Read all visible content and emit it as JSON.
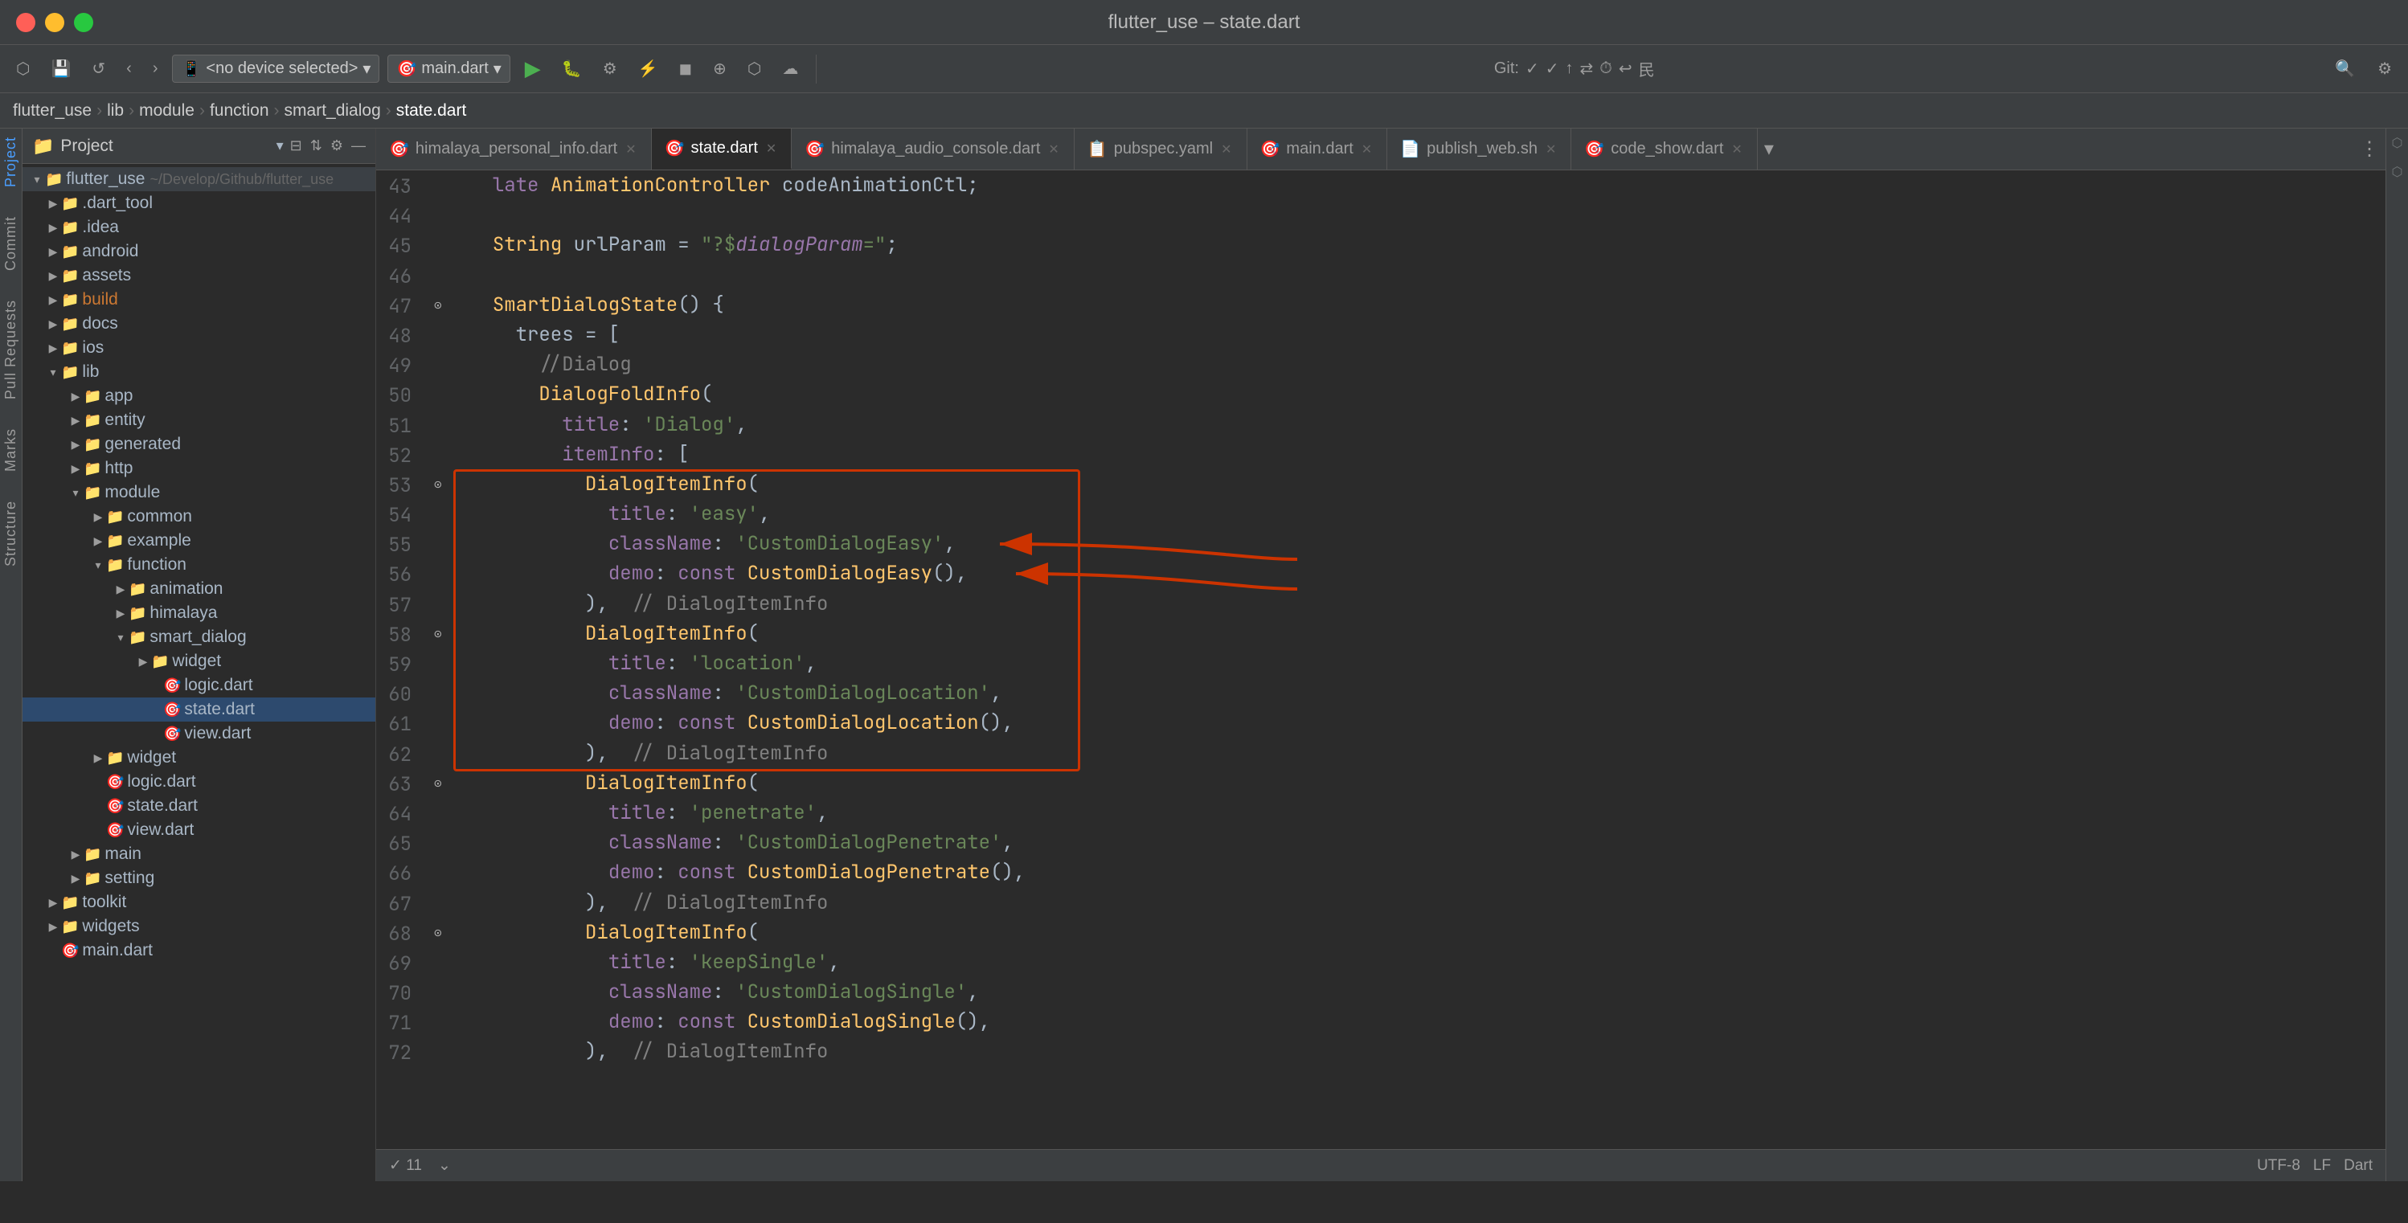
{
  "window": {
    "title": "flutter_use – state.dart"
  },
  "traffic_lights": {
    "close": "close",
    "minimize": "minimize",
    "maximize": "maximize"
  },
  "toolbar": {
    "back_label": "‹",
    "forward_label": "›",
    "device_selector": "<no device selected>",
    "file_selector": "main.dart",
    "run_label": "▶",
    "git_label": "Git:",
    "search_label": "🔍",
    "settings_label": "⚙"
  },
  "breadcrumb": {
    "items": [
      "flutter_use",
      "lib",
      "module",
      "function",
      "smart_dialog",
      "state.dart"
    ]
  },
  "sidebar": {
    "project_label": "Project",
    "labels": [
      "Project",
      "Commit",
      "Pull Requests",
      "Marks",
      "Structure"
    ]
  },
  "file_tree": {
    "root": "flutter_use",
    "root_path": "~/Develop/Github/flutter_use",
    "items": [
      {
        "type": "folder",
        "name": ".dart_tool",
        "level": 1,
        "collapsed": true,
        "color": "orange"
      },
      {
        "type": "folder",
        "name": ".idea",
        "level": 1,
        "collapsed": true
      },
      {
        "type": "folder",
        "name": "android",
        "level": 1,
        "collapsed": true
      },
      {
        "type": "folder",
        "name": "assets",
        "level": 1,
        "collapsed": true
      },
      {
        "type": "folder",
        "name": "build",
        "level": 1,
        "collapsed": true,
        "color": "orange"
      },
      {
        "type": "folder",
        "name": "docs",
        "level": 1,
        "collapsed": true
      },
      {
        "type": "folder",
        "name": "ios",
        "level": 1,
        "collapsed": true
      },
      {
        "type": "folder",
        "name": "lib",
        "level": 1,
        "collapsed": false
      },
      {
        "type": "folder",
        "name": "app",
        "level": 2,
        "collapsed": true
      },
      {
        "type": "folder",
        "name": "entity",
        "level": 2,
        "collapsed": true
      },
      {
        "type": "folder",
        "name": "generated",
        "level": 2,
        "collapsed": true
      },
      {
        "type": "folder",
        "name": "http",
        "level": 2,
        "collapsed": true
      },
      {
        "type": "folder",
        "name": "module",
        "level": 2,
        "collapsed": false
      },
      {
        "type": "folder",
        "name": "common",
        "level": 3,
        "collapsed": true
      },
      {
        "type": "folder",
        "name": "example",
        "level": 3,
        "collapsed": true
      },
      {
        "type": "folder",
        "name": "function",
        "level": 3,
        "collapsed": false
      },
      {
        "type": "folder",
        "name": "animation",
        "level": 4,
        "collapsed": true
      },
      {
        "type": "folder",
        "name": "himalaya",
        "level": 4,
        "collapsed": true
      },
      {
        "type": "folder",
        "name": "smart_dialog",
        "level": 4,
        "collapsed": false
      },
      {
        "type": "folder",
        "name": "widget",
        "level": 5,
        "collapsed": true
      },
      {
        "type": "file",
        "name": "logic.dart",
        "level": 5,
        "ext": "dart"
      },
      {
        "type": "file",
        "name": "state.dart",
        "level": 5,
        "ext": "dart",
        "selected": true
      },
      {
        "type": "file",
        "name": "view.dart",
        "level": 5,
        "ext": "dart"
      },
      {
        "type": "folder",
        "name": "widget",
        "level": 3,
        "collapsed": true
      },
      {
        "type": "file",
        "name": "logic.dart",
        "level": 3,
        "ext": "dart"
      },
      {
        "type": "file",
        "name": "state.dart",
        "level": 3,
        "ext": "dart"
      },
      {
        "type": "file",
        "name": "view.dart",
        "level": 3,
        "ext": "dart"
      },
      {
        "type": "folder",
        "name": "main",
        "level": 2,
        "collapsed": true
      },
      {
        "type": "folder",
        "name": "setting",
        "level": 2,
        "collapsed": true
      },
      {
        "type": "folder",
        "name": "toolkit",
        "level": 1,
        "collapsed": true
      },
      {
        "type": "folder",
        "name": "widgets",
        "level": 1,
        "collapsed": true
      },
      {
        "type": "file",
        "name": "main.dart",
        "level": 1,
        "ext": "dart"
      }
    ]
  },
  "tabs": [
    {
      "label": "himalaya_personal_info.dart",
      "active": false,
      "closeable": true
    },
    {
      "label": "state.dart",
      "active": true,
      "closeable": true
    },
    {
      "label": "himalaya_audio_console.dart",
      "active": false,
      "closeable": true
    },
    {
      "label": "pubspec.yaml",
      "active": false,
      "closeable": true
    },
    {
      "label": "main.dart",
      "active": false,
      "closeable": true
    },
    {
      "label": "publish_web.sh",
      "active": false,
      "closeable": true
    },
    {
      "label": "code_show.dart",
      "active": false,
      "closeable": true
    }
  ],
  "code": {
    "lines": [
      {
        "num": 43,
        "content": "  late AnimationController codeAnimationCtl;"
      },
      {
        "num": 44,
        "content": ""
      },
      {
        "num": 45,
        "content": "  String urlParam = \"?$dialogParam=\";"
      },
      {
        "num": 46,
        "content": ""
      },
      {
        "num": 47,
        "content": "  SmartDialogState() {"
      },
      {
        "num": 48,
        "content": "    trees = ["
      },
      {
        "num": 49,
        "content": "      //Dialog"
      },
      {
        "num": 50,
        "content": "      DialogFoldInfo("
      },
      {
        "num": 51,
        "content": "        title: 'Dialog',"
      },
      {
        "num": 52,
        "content": "        itemInfo: ["
      },
      {
        "num": 53,
        "content": "          DialogItemInfo("
      },
      {
        "num": 54,
        "content": "            title: 'easy',"
      },
      {
        "num": 55,
        "content": "            className: 'CustomDialogEasy',"
      },
      {
        "num": 56,
        "content": "            demo: const CustomDialogEasy(),"
      },
      {
        "num": 57,
        "content": "          ),  // DialogItemInfo"
      },
      {
        "num": 58,
        "content": "          DialogItemInfo("
      },
      {
        "num": 59,
        "content": "            title: 'location',"
      },
      {
        "num": 60,
        "content": "            className: 'CustomDialogLocation',"
      },
      {
        "num": 61,
        "content": "            demo: const CustomDialogLocation(),"
      },
      {
        "num": 62,
        "content": "          ),  // DialogItemInfo"
      },
      {
        "num": 63,
        "content": "          DialogItemInfo("
      },
      {
        "num": 64,
        "content": "            title: 'penetrate',"
      },
      {
        "num": 65,
        "content": "            className: 'CustomDialogPenetrate',"
      },
      {
        "num": 66,
        "content": "            demo: const CustomDialogPenetrate(),"
      },
      {
        "num": 67,
        "content": "          ),  // DialogItemInfo"
      },
      {
        "num": 68,
        "content": "          DialogItemInfo("
      },
      {
        "num": 69,
        "content": "            title: 'keepSingle',"
      },
      {
        "num": 70,
        "content": "            className: 'CustomDialogSingle',"
      },
      {
        "num": 71,
        "content": "            demo: const CustomDialogSingle(),"
      },
      {
        "num": 72,
        "content": "          ),  // DialogItemInfo"
      }
    ]
  },
  "annotation": {
    "box_label": "annotation box",
    "arrow1_label": "arrow pointing to className line 55",
    "arrow2_label": "arrow pointing to demo line 56"
  },
  "status_bar": {
    "line_col": "11",
    "encoding": "UTF-8",
    "line_ending": "LF",
    "indent": "Dart"
  }
}
